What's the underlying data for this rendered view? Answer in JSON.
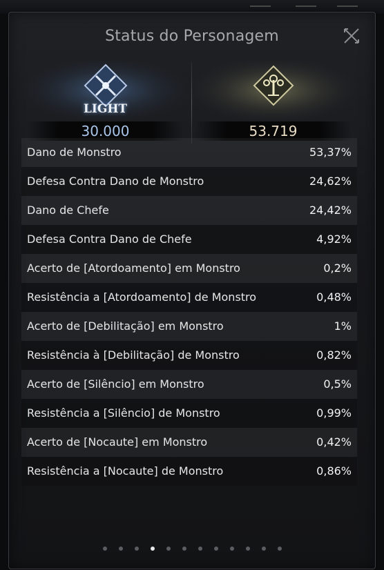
{
  "window": {
    "title": "Status do Personagem"
  },
  "emblems": {
    "light": {
      "badge_text": "LIGHT",
      "value": "30.000"
    },
    "tree": {
      "value": "53.719"
    }
  },
  "stats": [
    {
      "label": "Dano de Monstro",
      "value": "53,37%"
    },
    {
      "label": "Defesa Contra Dano de Monstro",
      "value": "24,62%"
    },
    {
      "label": "Dano de Chefe",
      "value": "24,42%"
    },
    {
      "label": "Defesa Contra Dano de Chefe",
      "value": "4,92%"
    },
    {
      "label": "Acerto de [Atordoamento] em Monstro",
      "value": "0,2%"
    },
    {
      "label": "Resistência a [Atordoamento] de Monstro",
      "value": "0,48%"
    },
    {
      "label": "Acerto de [Debilitação] em Monstro",
      "value": "1%"
    },
    {
      "label": "Resistência à [Debilitação] de Monstro",
      "value": "0,82%"
    },
    {
      "label": "Acerto de [Silêncio] em Monstro",
      "value": "0,5%"
    },
    {
      "label": "Resistência a [Silêncio] de Monstro",
      "value": "0,99%"
    },
    {
      "label": "Acerto de [Nocaute] em Monstro",
      "value": "0,42%"
    },
    {
      "label": "Resistência a [Nocaute] de Monstro",
      "value": "0,86%"
    }
  ],
  "pagination": {
    "total": 12,
    "active_index": 3
  },
  "colors": {
    "light_value": "#aac6ea",
    "tree_value": "#e8dcc4",
    "panel_bg": "#1b1c20"
  }
}
